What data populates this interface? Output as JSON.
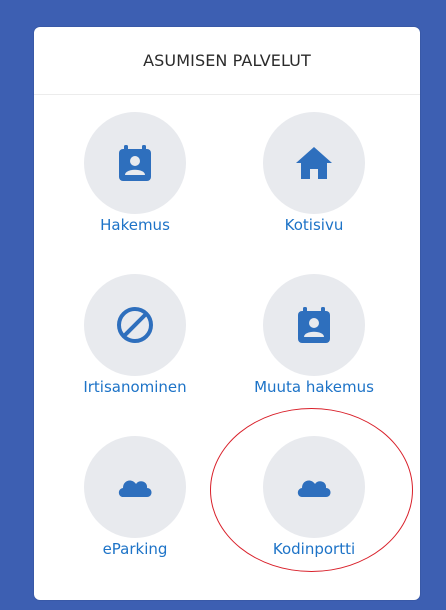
{
  "card": {
    "title": "ASUMISEN PALVELUT"
  },
  "tiles": [
    {
      "label": "Hakemus",
      "icon": "calendar-user-icon"
    },
    {
      "label": "Kotisivu",
      "icon": "home-icon"
    },
    {
      "label": "Irtisanominen",
      "icon": "prohibited-icon"
    },
    {
      "label": "Muuta hakemus",
      "icon": "calendar-user-icon"
    },
    {
      "label": "eParking",
      "icon": "cloud-icon"
    },
    {
      "label": "Kodinportti",
      "icon": "cloud-icon"
    }
  ],
  "colors": {
    "background": "#3d5fb2",
    "card": "#ffffff",
    "icon_circle": "#e8eaee",
    "icon": "#2e6fbd",
    "link": "#1d73c7",
    "annotation": "#d9202a"
  }
}
